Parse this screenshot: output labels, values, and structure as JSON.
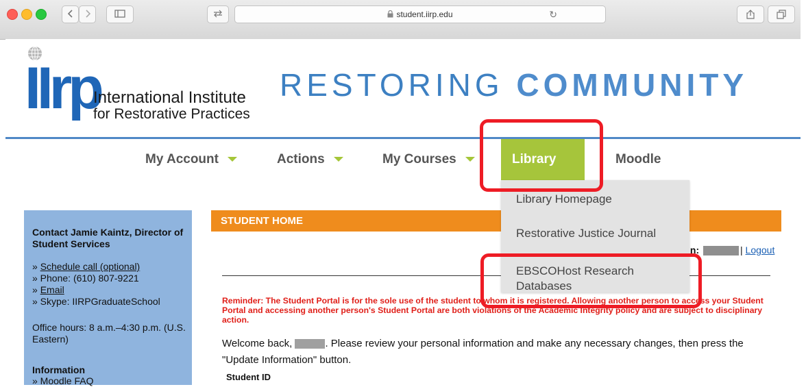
{
  "browser": {
    "url": "student.iirp.edu"
  },
  "header": {
    "logo_letters": "IIrp",
    "logo_name_line1": "International Institute",
    "logo_name_line2": "for Restorative Practices",
    "tagline_light": "RESTORING ",
    "tagline_bold": "COMMUNITY"
  },
  "nav": {
    "items": [
      {
        "label": "My Account"
      },
      {
        "label": "Actions"
      },
      {
        "label": "My Courses"
      },
      {
        "label": "Library"
      },
      {
        "label": "Moodle"
      }
    ],
    "active": "Library",
    "dropdown": [
      "Library Homepage",
      "Restorative Justice Journal",
      "EBSCOHost Research Databases"
    ]
  },
  "sidebar": {
    "contact_title": "Contact Jamie Kaintz, Director of Student Services",
    "schedule_link": "Schedule call (optional)",
    "phone": "» Phone: (610) 807-9221",
    "email_link": "Email",
    "skype": "» Skype: IIRPGraduateSchool",
    "office_hours": "Office hours: 8 a.m.–4:30 p.m. (U.S. Eastern)",
    "info_title": "Information",
    "moodle_faq": "» Moodle FAQ"
  },
  "main": {
    "section_title": "STUDENT HOME",
    "login_label": "in:",
    "logout": "Logout",
    "reminder": "Reminder: The Student Portal is for the sole use of the student to whom it is registered. Allowing another person to access your Student Portal and accessing another person's Student Portal are both violations of the Academic Integrity policy and are subject to disciplinary action.",
    "welcome_prefix": "Welcome back,",
    "welcome_suffix": ". Please review your personal information and make any necessary changes, then press the \"Update Information\" button.",
    "student_id_label": "Student ID"
  },
  "colors": {
    "nav_active": "#a6c53b",
    "section_header": "#ef8c1d",
    "sidebar": "#8fb4de",
    "highlight": "#ee1c25",
    "reminder": "#e0201a"
  }
}
